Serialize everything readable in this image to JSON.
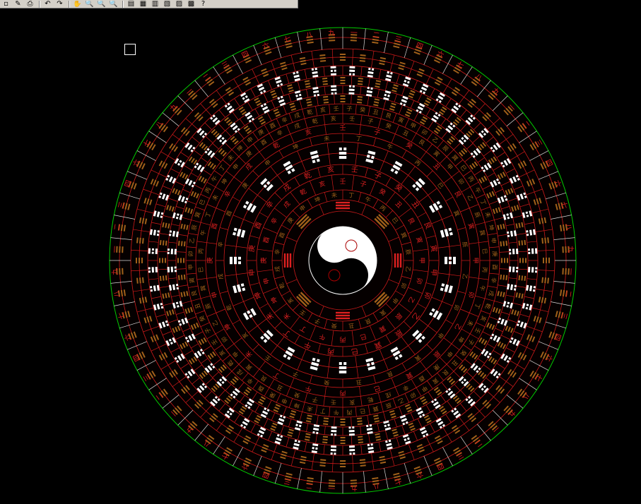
{
  "toolbar": {
    "buttons": [
      {
        "name": "new-icon",
        "glyph": "▫"
      },
      {
        "name": "match-properties-icon",
        "glyph": "✎"
      },
      {
        "name": "plot-preview-icon",
        "glyph": "⎙"
      },
      {
        "name": "undo-icon",
        "glyph": "↶"
      },
      {
        "name": "redo-icon",
        "glyph": "↷"
      },
      {
        "name": "pan-icon",
        "glyph": "✋"
      },
      {
        "name": "zoom-realtime-icon",
        "glyph": "🔍"
      },
      {
        "name": "zoom-window-icon",
        "glyph": "🔍"
      },
      {
        "name": "zoom-previous-icon",
        "glyph": "🔍"
      },
      {
        "name": "properties-icon",
        "glyph": "▤"
      },
      {
        "name": "design-center-icon",
        "glyph": "▦"
      },
      {
        "name": "tool-palettes-icon",
        "glyph": "▥"
      },
      {
        "name": "sheet-set-icon",
        "glyph": "▧"
      },
      {
        "name": "markup-icon",
        "glyph": "▨"
      },
      {
        "name": "calculator-icon",
        "glyph": "▩"
      },
      {
        "name": "help-icon",
        "glyph": "?"
      }
    ]
  },
  "compass": {
    "colors": {
      "background": "#000000",
      "outer_circle": "#00cc00",
      "ring_lines": "#cc1a1a",
      "red_text": "#dd2020",
      "brown": "#a0601a",
      "white": "#ffffff"
    },
    "ring_labels": {
      "ring12": [
        "子",
        "癸",
        "丑",
        "艮",
        "寅",
        "甲",
        "卯",
        "乙",
        "辰",
        "巽",
        "巳",
        "丙",
        "午",
        "丁",
        "未",
        "坤",
        "申",
        "庚",
        "酉",
        "辛",
        "戌",
        "乾",
        "亥",
        "壬"
      ],
      "ring8": [
        "丁",
        "午",
        "丙",
        "巳",
        "巽",
        "辰",
        "乙",
        "卯",
        "甲",
        "寅",
        "艮",
        "丑",
        "癸",
        "子",
        "壬",
        "亥",
        "乾",
        "戌",
        "辛",
        "酉",
        "庚",
        "申",
        "坤",
        "未"
      ],
      "ring5": [
        "壬",
        "子",
        "癸",
        "丑",
        "艮",
        "寅",
        "甲",
        "卯",
        "乙",
        "辰",
        "巽",
        "巳",
        "丙",
        "午",
        "丁",
        "未",
        "坤",
        "申",
        "庚",
        "酉",
        "辛",
        "戌",
        "乾",
        "亥"
      ],
      "ring2": [
        "子",
        "丑",
        "寅",
        "卯",
        "辰",
        "巳",
        "午",
        "未",
        "申",
        "酉",
        "戌",
        "亥"
      ],
      "outer_numbers": [
        "一",
        "二",
        "三",
        "四",
        "六",
        "七",
        "八",
        "九"
      ]
    }
  }
}
